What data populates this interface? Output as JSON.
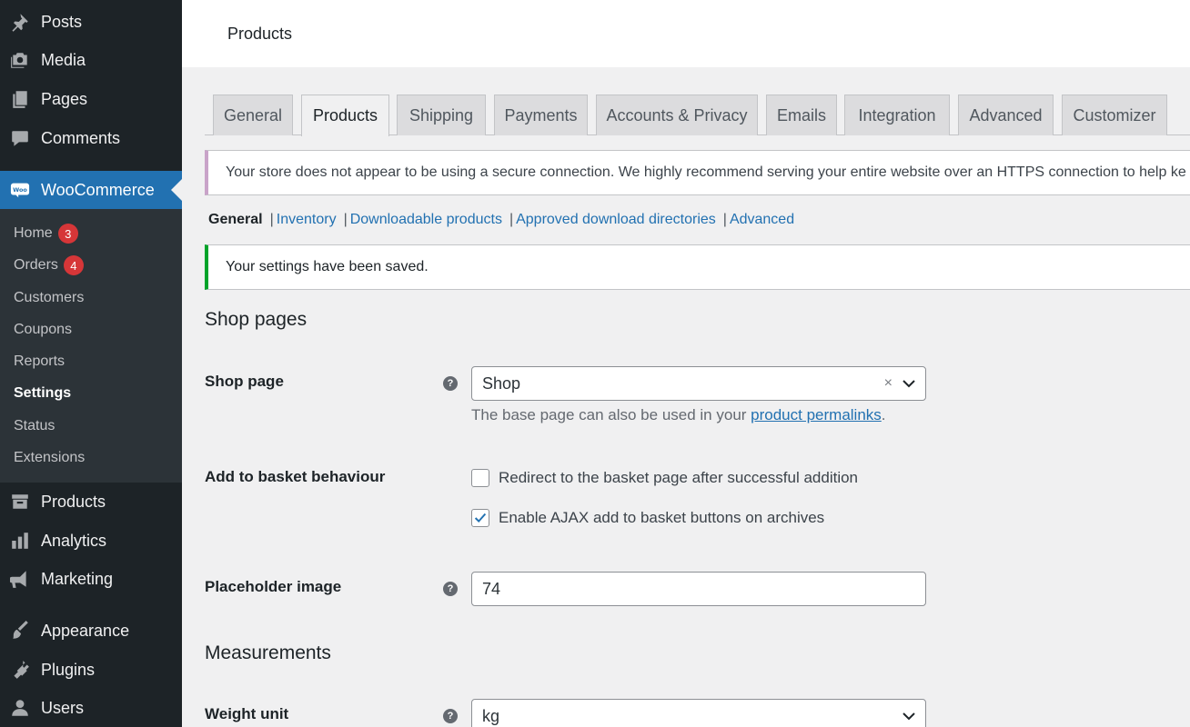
{
  "sidebar": {
    "top_items": [
      {
        "label": "Posts",
        "icon": "pin-icon"
      },
      {
        "label": "Media",
        "icon": "media-icon"
      },
      {
        "label": "Pages",
        "icon": "pages-icon"
      },
      {
        "label": "Comments",
        "icon": "comment-icon"
      }
    ],
    "woocommerce": {
      "label": "WooCommerce",
      "icon": "woo-icon"
    },
    "submenu": [
      {
        "label": "Home",
        "badge": "3"
      },
      {
        "label": "Orders",
        "badge": "4"
      },
      {
        "label": "Customers"
      },
      {
        "label": "Coupons"
      },
      {
        "label": "Reports"
      },
      {
        "label": "Settings",
        "current": true
      },
      {
        "label": "Status"
      },
      {
        "label": "Extensions"
      }
    ],
    "bottom_items": [
      {
        "label": "Products",
        "icon": "archive-icon"
      },
      {
        "label": "Analytics",
        "icon": "bar-chart-icon"
      },
      {
        "label": "Marketing",
        "icon": "megaphone-icon"
      },
      {
        "label": "Appearance",
        "icon": "brush-icon"
      },
      {
        "label": "Plugins",
        "icon": "plug-icon"
      },
      {
        "label": "Users",
        "icon": "user-icon"
      }
    ]
  },
  "header": {
    "title": "Products"
  },
  "tabs": [
    "General",
    "Products",
    "Shipping",
    "Payments",
    "Accounts & Privacy",
    "Emails",
    "Integration",
    "Advanced",
    "Customizer"
  ],
  "active_tab": "Products",
  "notice_https": "Your store does not appear to be using a secure connection. We highly recommend serving your entire website over an HTTPS connection to help ke",
  "subnav": {
    "current": "General",
    "links": [
      "Inventory",
      "Downloadable products",
      "Approved download directories",
      "Advanced"
    ]
  },
  "notice_saved": "Your settings have been saved.",
  "shop_pages": {
    "heading": "Shop pages",
    "shop_page_label": "Shop page",
    "shop_page_value": "Shop",
    "clear_glyph": "×",
    "desc_pre": "The base page can also be used in your ",
    "desc_link": "product permalinks",
    "desc_post": ".",
    "basket_label": "Add to basket behaviour",
    "cb_redirect": "Redirect to the basket page after successful addition",
    "cb_ajax": "Enable AJAX add to basket buttons on archives",
    "placeholder_label": "Placeholder image",
    "placeholder_value": "74"
  },
  "measurements": {
    "heading": "Measurements",
    "weight_label": "Weight unit",
    "weight_value": "kg"
  },
  "help_glyph": "?",
  "colors": {
    "sidebar": "#1d2327",
    "accent": "#2271b1",
    "success": "#00a32a",
    "badge": "#d63638"
  }
}
